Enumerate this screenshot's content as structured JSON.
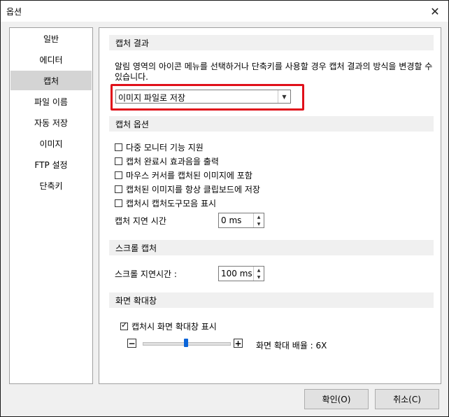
{
  "window": {
    "title": "옵션",
    "close_symbol": "✕"
  },
  "sidebar": {
    "items": [
      {
        "label": "일반",
        "selected": false
      },
      {
        "label": "에디터",
        "selected": false
      },
      {
        "label": "캡처",
        "selected": true
      },
      {
        "label": "파일 이름",
        "selected": false
      },
      {
        "label": "자동 저장",
        "selected": false
      },
      {
        "label": "이미지",
        "selected": false
      },
      {
        "label": "FTP 설정",
        "selected": false
      },
      {
        "label": "단축키",
        "selected": false
      }
    ]
  },
  "capture_result": {
    "header": "캡처 결과",
    "description": "알림 영역의 아이콘 메뉴를 선택하거나 단축키를 사용할 경우 캡처 결과의 방식을 변경할 수 있습니다.",
    "selected_option": "이미지 파일로 저장",
    "dropdown_icon": "chevron-down-icon"
  },
  "capture_options": {
    "header": "캡처 옵션",
    "checkboxes": [
      {
        "label": "다중 모니터 기능 지원",
        "checked": false
      },
      {
        "label": "캡처 완료시 효과음을 출력",
        "checked": false
      },
      {
        "label": "마우스 커서를 캡처된 이미지에 포함",
        "checked": false
      },
      {
        "label": "캡처된 이미지를 항상 클립보드에 저장",
        "checked": false
      },
      {
        "label": "캡처시 캡처도구모음 표시",
        "checked": false
      }
    ],
    "delay_label": "캡처 지연 시간",
    "delay_value": "0 ms"
  },
  "scroll_capture": {
    "header": "스크롤 캡처",
    "delay_label": "스크롤 지연시간 :",
    "delay_value": "100 ms"
  },
  "magnifier": {
    "header": "화면 확대창",
    "show_label": "캡처시 화면 확대창 표시",
    "show_checked": true,
    "minus_symbol": "−",
    "plus_symbol": "+",
    "zoom_label": "화면 확대 배율 : 6X",
    "zoom_level_fraction": 0.5
  },
  "buttons": {
    "ok": "확인(O)",
    "cancel": "취소(C)"
  },
  "colors": {
    "highlight_border": "#e0101a",
    "slider_thumb": "#0a64d8",
    "selected_item": "#d4d4d4"
  }
}
